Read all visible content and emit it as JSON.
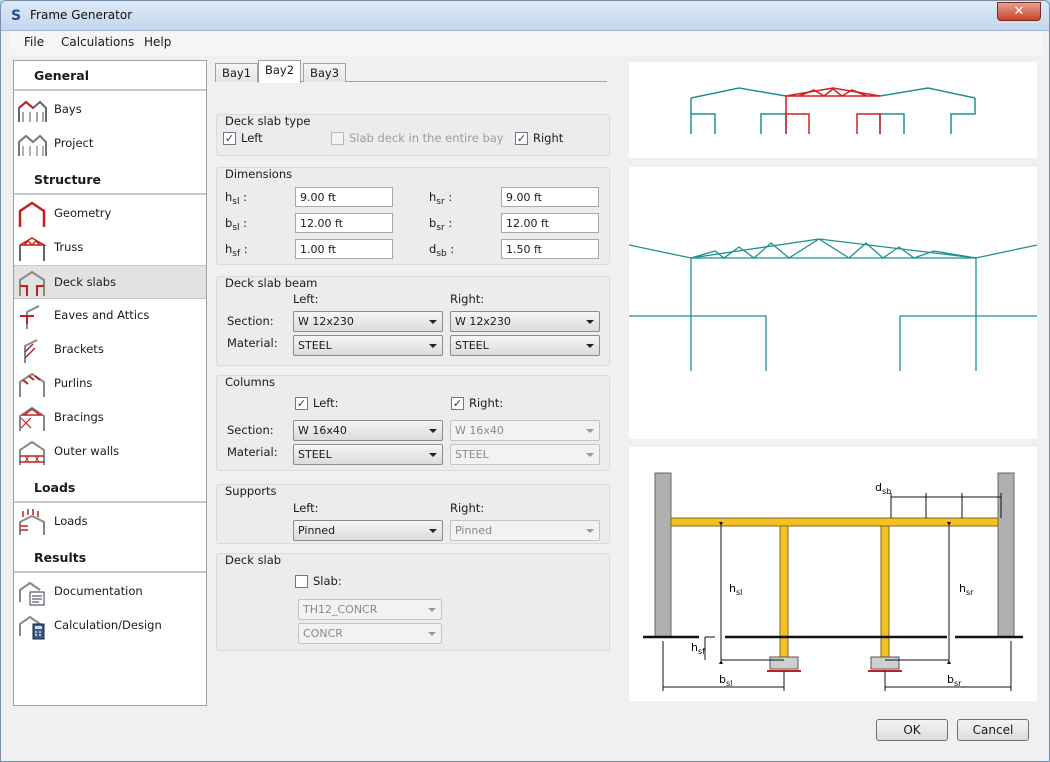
{
  "window": {
    "title": "Frame Generator",
    "app_icon": "S"
  },
  "menu": [
    "File",
    "Calculations",
    "Help"
  ],
  "sidebar": {
    "sections": [
      {
        "title": "General",
        "items": [
          "Bays",
          "Project"
        ]
      },
      {
        "title": "Structure",
        "items": [
          "Geometry",
          "Truss",
          "Deck slabs",
          "Eaves and Attics",
          "Brackets",
          "Purlins",
          "Bracings",
          "Outer walls"
        ]
      },
      {
        "title": "Loads",
        "items": [
          "Loads"
        ]
      },
      {
        "title": "Results",
        "items": [
          "Documentation",
          "Calculation/Design"
        ]
      }
    ],
    "selected": "Deck slabs"
  },
  "tabs": [
    "Bay1",
    "Bay2",
    "Bay3"
  ],
  "active_tab": "Bay2",
  "deck_slab_type": {
    "title": "Deck slab type",
    "left": {
      "label": "Left",
      "checked": true
    },
    "entire": {
      "label": "Slab deck in the entire bay",
      "checked": false
    },
    "right": {
      "label": "Right",
      "checked": true
    }
  },
  "dimensions": {
    "title": "Dimensions",
    "fields": [
      {
        "sym": "h",
        "sub": "sl",
        "value": "9.00 ft"
      },
      {
        "sym": "h",
        "sub": "sr",
        "value": "9.00 ft"
      },
      {
        "sym": "b",
        "sub": "sl",
        "value": "12.00 ft"
      },
      {
        "sym": "b",
        "sub": "sr",
        "value": "12.00 ft"
      },
      {
        "sym": "h",
        "sub": "sf",
        "value": "1.00 ft"
      },
      {
        "sym": "d",
        "sub": "sb",
        "value": "1.50 ft"
      }
    ]
  },
  "deck_slab_beam": {
    "title": "Deck slab beam",
    "left_label": "Left:",
    "right_label": "Right:",
    "section_label": "Section:",
    "material_label": "Material:",
    "left_section": "W 12x230",
    "right_section": "W 12x230",
    "left_material": "STEEL",
    "right_material": "STEEL"
  },
  "columns": {
    "title": "Columns",
    "left": {
      "label": "Left:",
      "checked": true
    },
    "right": {
      "label": "Right:",
      "checked": true
    },
    "section_label": "Section:",
    "material_label": "Material:",
    "left_section": "W 16x40",
    "right_section": "W 16x40",
    "left_material": "STEEL",
    "right_material": "STEEL"
  },
  "supports": {
    "title": "Supports",
    "left_label": "Left:",
    "right_label": "Right:",
    "left_value": "Pinned",
    "right_value": "Pinned"
  },
  "deck_slab": {
    "title": "Deck slab",
    "slab": {
      "label": "Slab:",
      "checked": false
    },
    "thickness": "TH12_CONCR",
    "material": "CONCR"
  },
  "diagram_labels": {
    "dsb": [
      "d",
      "sb"
    ],
    "hsl": [
      "h",
      "sl"
    ],
    "hsr": [
      "h",
      "sr"
    ],
    "hsf": [
      "h",
      "sf"
    ],
    "bsl": [
      "b",
      "sl"
    ],
    "bsr": [
      "b",
      "sr"
    ]
  },
  "buttons": {
    "ok": "OK",
    "cancel": "Cancel"
  },
  "colors": {
    "teal": "#1f9090",
    "red": "#d42020",
    "beam": "#f4c02a"
  },
  "icons": {
    "check": "✓",
    "close": "✕"
  }
}
